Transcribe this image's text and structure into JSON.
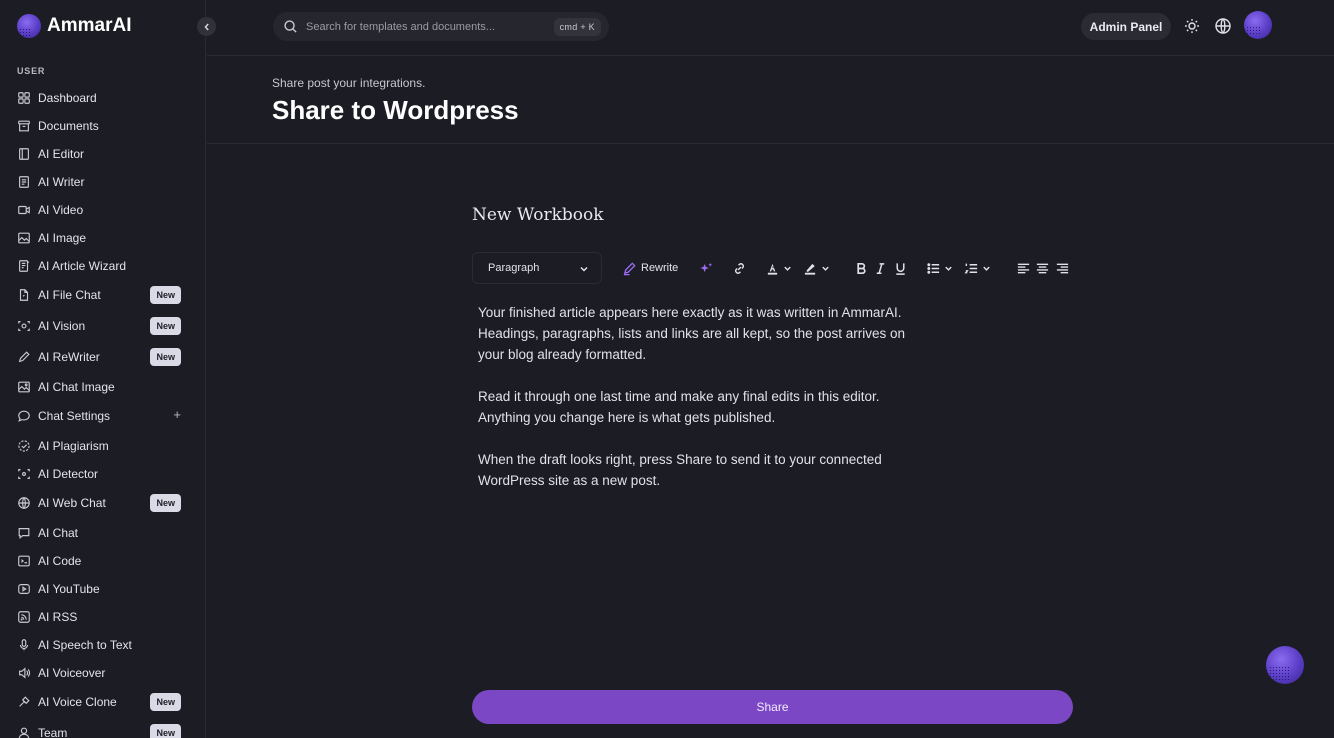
{
  "brand": {
    "name": "AmmarAI"
  },
  "sidebar": {
    "section_label": "USER",
    "items": [
      {
        "label": "Dashboard",
        "icon": "dashboard-icon"
      },
      {
        "label": "Documents",
        "icon": "archive-icon"
      },
      {
        "label": "AI Editor",
        "icon": "book-icon"
      },
      {
        "label": "AI Writer",
        "icon": "file-text-icon"
      },
      {
        "label": "AI Video",
        "icon": "video-icon"
      },
      {
        "label": "AI Image",
        "icon": "image-icon"
      },
      {
        "label": "AI Article Wizard",
        "icon": "wizard-icon"
      },
      {
        "label": "AI File Chat",
        "icon": "file-chat-icon",
        "badge": "New"
      },
      {
        "label": "AI Vision",
        "icon": "scan-eye-icon",
        "badge": "New"
      },
      {
        "label": "AI ReWriter",
        "icon": "pencil-icon",
        "badge": "New"
      },
      {
        "label": "AI Chat Image",
        "icon": "chat-image-icon"
      },
      {
        "label": "Chat Settings",
        "icon": "chat-bubble-icon",
        "plus": "+"
      },
      {
        "label": "AI Plagiarism",
        "icon": "check-circle-icon"
      },
      {
        "label": "AI Detector",
        "icon": "scan-icon"
      },
      {
        "label": "AI Web Chat",
        "icon": "globe-icon",
        "badge": "New"
      },
      {
        "label": "AI Chat",
        "icon": "message-icon"
      },
      {
        "label": "AI Code",
        "icon": "terminal-icon"
      },
      {
        "label": "AI YouTube",
        "icon": "youtube-icon"
      },
      {
        "label": "AI RSS",
        "icon": "rss-icon"
      },
      {
        "label": "AI Speech to Text",
        "icon": "microphone-icon"
      },
      {
        "label": "AI Voiceover",
        "icon": "speaker-icon"
      },
      {
        "label": "AI Voice Clone",
        "icon": "voice-clone-icon",
        "badge": "New"
      },
      {
        "label": "Team",
        "icon": "user-icon",
        "badge": "New"
      }
    ]
  },
  "search": {
    "placeholder": "Search for templates and documents...",
    "shortcut": "cmd + K"
  },
  "header": {
    "admin_label": "Admin Panel"
  },
  "page": {
    "subtitle": "Share post your integrations.",
    "title": "Share to Wordpress"
  },
  "editor": {
    "doc_title": "New Workbook",
    "block_type": "Paragraph",
    "rewrite_label": "Rewrite",
    "paragraphs": [
      "Your finished article appears here exactly as it was written in AmmarAI. Headings, paragraphs, lists and links are all kept, so the post arrives on your blog already formatted.",
      "Read it through one last time and make any final edits in this editor. Anything you change here is what gets published.",
      "When the draft looks right, press Share to send it to your connected WordPress site as a new post."
    ]
  },
  "actions": {
    "share_label": "Share"
  },
  "colors": {
    "accent": "#7c47c4",
    "background": "#1c1d24"
  }
}
